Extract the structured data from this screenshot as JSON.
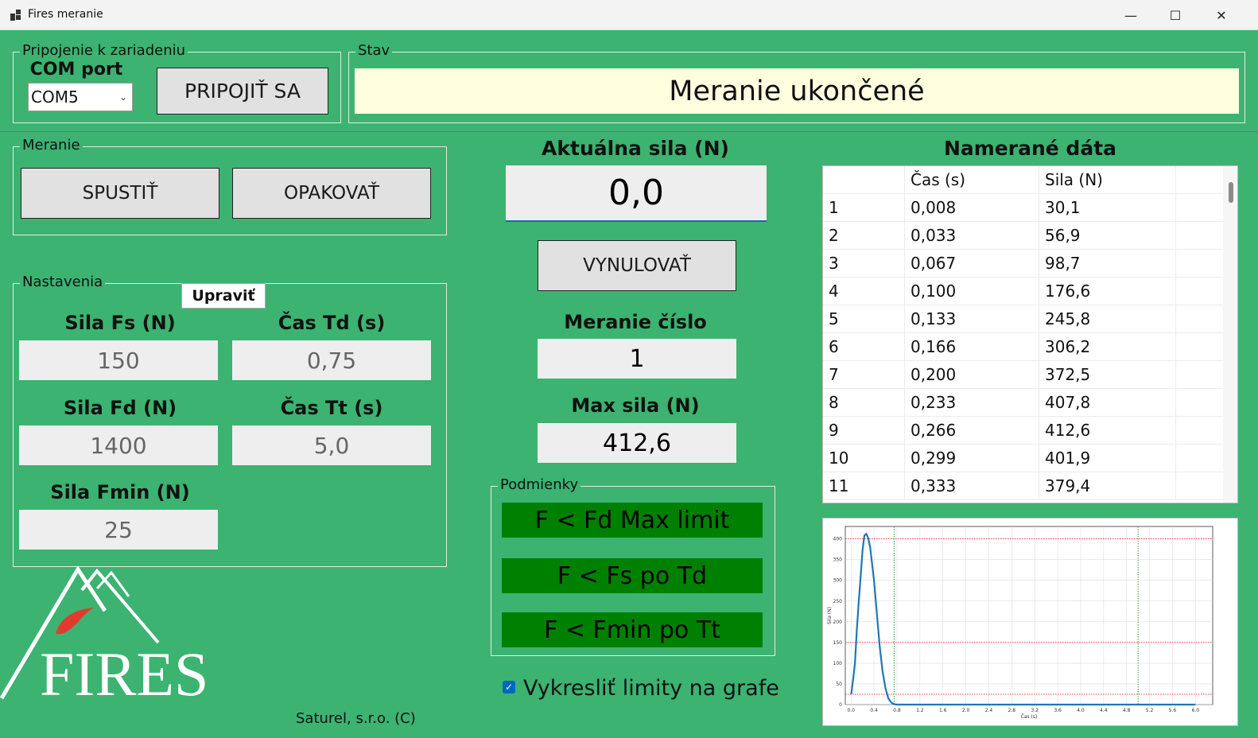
{
  "window": {
    "title": "Fires meranie",
    "minimize": "—",
    "maximize": "☐",
    "close": "✕"
  },
  "connection": {
    "legend": "Pripojenie k zariadeniu",
    "com_label": "COM port",
    "com_value": "COM5",
    "connect_button": "PRIPOJIŤ SA"
  },
  "status": {
    "legend": "Stav",
    "text": "Meranie ukončené",
    "bg_color": "#ffffe0"
  },
  "measurement": {
    "legend": "Meranie",
    "start_button": "SPUSTIŤ",
    "repeat_button": "OPAKOVAŤ"
  },
  "settings": {
    "legend": "Nastavenia",
    "edit_button": "Upraviť",
    "fs_label": "Sila Fs (N)",
    "fs_value": "150",
    "td_label": "Čas Td (s)",
    "td_value": "0,75",
    "fd_label": "Sila Fd (N)",
    "fd_value": "1400",
    "tt_label": "Čas Tt (s)",
    "tt_value": "5,0",
    "fmin_label": "Sila Fmin (N)",
    "fmin_value": "25"
  },
  "live": {
    "force_label": "Aktuálna sila (N)",
    "force_value": "0,0",
    "zero_button": "VYNULOVAŤ",
    "number_label": "Meranie číslo",
    "number_value": "1",
    "max_label": "Max sila (N)",
    "max_value": "412,6"
  },
  "conditions": {
    "legend": "Podmienky",
    "c1": "F < Fd Max limit",
    "c2": "F < Fs po Td",
    "c3": "F < Fmin po Tt",
    "color": "#008000"
  },
  "draw_limits": {
    "label": "Vykresliť limity na grafe",
    "checked": true
  },
  "logo": {
    "text": "FIRES"
  },
  "footer": "Saturel, s.r.o. (C)",
  "data_table": {
    "title": "Namerané dáta",
    "columns": [
      "",
      "Čas (s)",
      "Sila (N)"
    ],
    "rows": [
      [
        "1",
        "0,008",
        "30,1"
      ],
      [
        "2",
        "0,033",
        "56,9"
      ],
      [
        "3",
        "0,067",
        "98,7"
      ],
      [
        "4",
        "0,100",
        "176,6"
      ],
      [
        "5",
        "0,133",
        "245,8"
      ],
      [
        "6",
        "0,166",
        "306,2"
      ],
      [
        "7",
        "0,200",
        "372,5"
      ],
      [
        "8",
        "0,233",
        "407,8"
      ],
      [
        "9",
        "0,266",
        "412,6"
      ],
      [
        "10",
        "0,299",
        "401,9"
      ],
      [
        "11",
        "0,333",
        "379,4"
      ]
    ]
  },
  "chart_data": {
    "type": "line",
    "xlabel": "Čas (s)",
    "ylabel": "Sila (N)",
    "xlim": [
      -0.1,
      6.3
    ],
    "ylim": [
      0,
      430
    ],
    "xticks": [
      "0.0",
      "0.4",
      "0.8",
      "1.2",
      "1.6",
      "2.0",
      "2.4",
      "2.8",
      "3.2",
      "3.6",
      "4.0",
      "4.4",
      "4.8",
      "5.2",
      "5.6",
      "6.0"
    ],
    "yticks": [
      "0",
      "50",
      "100",
      "150",
      "200",
      "250",
      "300",
      "350",
      "400"
    ],
    "grid": true,
    "series": [
      {
        "color": "#1f77b4",
        "x": [
          0.0,
          0.008,
          0.033,
          0.067,
          0.1,
          0.133,
          0.166,
          0.2,
          0.233,
          0.266,
          0.299,
          0.333,
          0.4,
          0.45,
          0.5,
          0.55,
          0.6,
          0.65,
          0.7,
          0.75,
          0.8,
          1.0,
          2.0,
          3.0,
          4.0,
          5.0,
          6.0
        ],
        "y": [
          25,
          30.1,
          56.9,
          98.7,
          176.6,
          245.8,
          306.2,
          372.5,
          407.8,
          412.6,
          401.9,
          379.4,
          300,
          220,
          140,
          80,
          40,
          15,
          5,
          1,
          0,
          0,
          0,
          0,
          0,
          0,
          0
        ]
      }
    ],
    "limit_lines": {
      "horizontal": [
        {
          "y": 400,
          "color": "#ff0000"
        },
        {
          "y": 150,
          "color": "#ff0000"
        },
        {
          "y": 25,
          "color": "#ff0000"
        }
      ],
      "vertical": [
        {
          "x": 0.75,
          "color": "#008000"
        },
        {
          "x": 5.0,
          "color": "#008000"
        }
      ]
    }
  }
}
